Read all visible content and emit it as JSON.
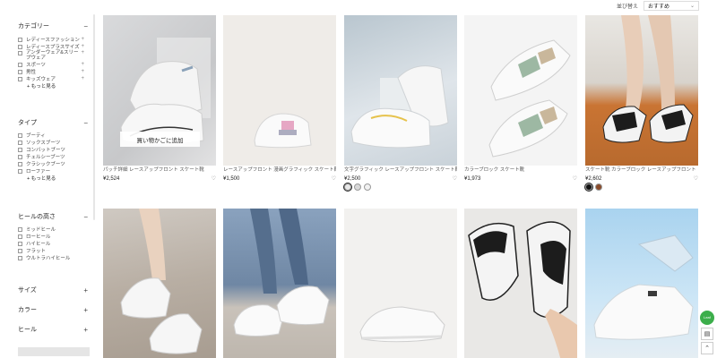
{
  "sort": {
    "label": "並び替え",
    "selected": "おすすめ"
  },
  "sidebar": {
    "category": {
      "title": "カテゴリー",
      "toggle": "−",
      "items": [
        {
          "label": "レディースファッション",
          "plus": "+"
        },
        {
          "label": "レディースプラスサイズ",
          "plus": "+"
        },
        {
          "label": "アンダーウェア&スリープウェア",
          "plus": "+"
        },
        {
          "label": "スポーツ",
          "plus": "+"
        },
        {
          "label": "男性",
          "plus": "+"
        },
        {
          "label": "キッズウェア",
          "plus": "+"
        }
      ],
      "more": "+ もっと見る"
    },
    "type": {
      "title": "タイプ",
      "toggle": "−",
      "items": [
        "ブーティ",
        "ソックスブーツ",
        "コンバットブーツ",
        "チェルシーブーツ",
        "クラシックブーツ",
        "ローファー"
      ],
      "more": "+ もっと見る"
    },
    "heel": {
      "title": "ヒールの高さ",
      "toggle": "−",
      "items": [
        "ミッドヒール",
        "ローヒール",
        "ハイヒール",
        "フラット",
        "ウルトラハイヒール"
      ]
    },
    "size": {
      "title": "サイズ",
      "toggle": "+"
    },
    "color": {
      "title": "カラー",
      "toggle": "+"
    },
    "heel2": {
      "title": "ヒール",
      "toggle": "+"
    }
  },
  "products": [
    {
      "title": "パッチ詳細 レースアップフロント スケート靴",
      "price": "¥2,524",
      "add_cart": "買い物かごに追加"
    },
    {
      "title": "レースアップフロント 漫画グラフィック スケート靴",
      "price": "¥1,500"
    },
    {
      "title": "文字グラフィック レースアップフロント スケート靴",
      "price": "¥2,500"
    },
    {
      "title": "カラーブロック スケート靴",
      "price": "¥1,973"
    },
    {
      "title": "スケート靴 カラーブロック レースアップフロント",
      "price": "¥2,602"
    }
  ],
  "swatches": {
    "p3": [
      "#e8e8e8",
      "#d8d8d8",
      "#f2f2f2"
    ],
    "p5": [
      "#111111",
      "#8a4b2a"
    ]
  },
  "colors": {
    "accent": "#222222",
    "badge": "#3cae4b"
  },
  "badge_text": "Leaf"
}
